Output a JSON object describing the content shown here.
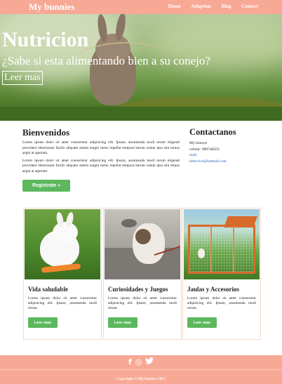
{
  "header": {
    "brand": "My bunnies",
    "nav": [
      "Home",
      "Adoption",
      "Blog",
      "Contact"
    ]
  },
  "hero": {
    "title": "Nutricion",
    "subtitle": "¿Sabe si esta alimentando bien a su conejo?",
    "button": "Leer mas"
  },
  "welcome": {
    "title": "Bienvenidos",
    "paragraphs": [
      "Lorem ipsum dolor sit amet consectetur adipisicing elit. Ipsum, assumenda modi rerum eligendi provident laboriosam facilis aliquam autem magni nemo repellat tempora harum soluta ipsa sint minus aegui at agertam.",
      "Lorem ipsum dolor sit amet consectetur adipisicing elit. Ipsum, assumenda modi rerum eligendi provident laboriosam facilis aliquam autem magni nemo repellat tempora harum soluta ipsa sint minus aegui at agertam."
    ],
    "button": "Registrate »"
  },
  "contact": {
    "title": "Contactanos",
    "lines": [
      "My bunnye",
      "celular: 9807dd563",
      "mail:",
      "bettyvice@hotmail.com"
    ]
  },
  "cards": [
    {
      "title": "Vida saludable",
      "text": "Lorem ipsum dolor sit amet consectetur adipisicing elit. Ipsum, assumenda modi rerum.",
      "button": "Leer mas"
    },
    {
      "title": "Curiosidades y Juegos",
      "text": "Lorem ipsum dolor sit amet consectetur adipisicing elit. Ipsum, assumenda modi rerum.",
      "button": "Leer mas"
    },
    {
      "title": "Jaulas y Accesorios",
      "text": "Lorem ipsum dolor sit amet consectetur adipisicing elit. Ipsum, assumenda modi rerum.",
      "button": "Leer mas"
    }
  ],
  "footer": {
    "social": {
      "facebook": "f",
      "instagram": "◎",
      "twitter": "🐦"
    },
    "copyright": "Copyright © My bunnye 2017"
  },
  "colors": {
    "accent": "#f7a995",
    "button": "#5cb85c"
  }
}
